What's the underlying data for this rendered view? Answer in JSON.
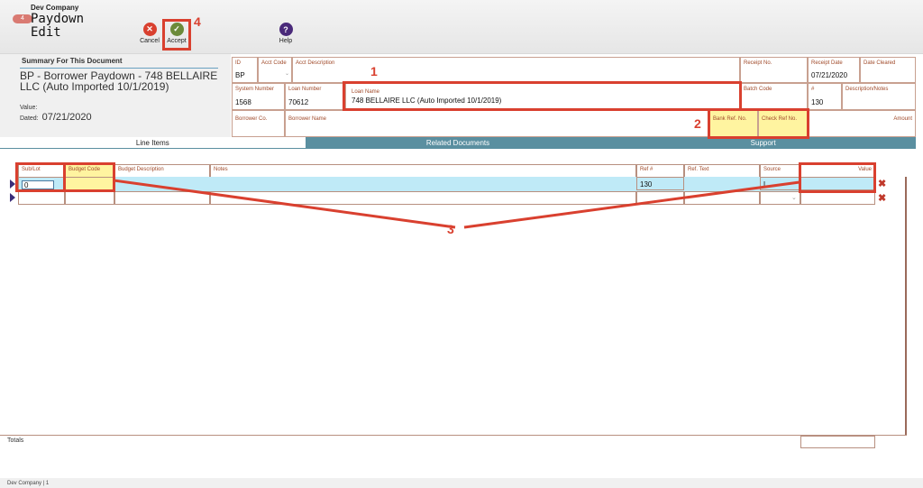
{
  "header": {
    "company": "Dev Company",
    "notifications": "4",
    "module_title_line1": "Paydown",
    "module_title_line2": "Edit",
    "cancel_label": "Cancel",
    "accept_label": "Accept",
    "help_label": "Help"
  },
  "summary": {
    "heading": "Summary For This Document",
    "title": "BP - Borrower Paydown - 748 BELLAIRE LLC (Auto Imported 10/1/2019)",
    "value_label": "Value:",
    "dated_label": "Dated:",
    "dated_value": "07/21/2020"
  },
  "fields": {
    "id": {
      "label": "ID",
      "value": "BP"
    },
    "acct_code": {
      "label": "Acct Code",
      "value": ""
    },
    "acct_description": {
      "label": "Acct Description",
      "value": ""
    },
    "receipt_no": {
      "label": "Receipt No.",
      "value": ""
    },
    "receipt_date": {
      "label": "Receipt Date",
      "value": "07/21/2020"
    },
    "date_cleared": {
      "label": "Date Cleared",
      "value": ""
    },
    "system_number": {
      "label": "System Number",
      "value": "1568"
    },
    "loan_number": {
      "label": "Loan Number",
      "value": "70612"
    },
    "loan_name": {
      "label": "Loan Name",
      "value": "748 BELLAIRE LLC (Auto Imported 10/1/2019)"
    },
    "batch_code": {
      "label": "Batch Code",
      "value": ""
    },
    "number": {
      "label": "#",
      "value": "130"
    },
    "description_notes": {
      "label": "Description/Notes",
      "value": ""
    },
    "borrower_co": {
      "label": "Borrower Co.",
      "value": ""
    },
    "borrower_name": {
      "label": "Borrower Name",
      "value": ""
    },
    "bank_ref_no": {
      "label": "Bank Ref. No.",
      "value": ""
    },
    "check_ref_no": {
      "label": "Check Ref No.",
      "value": ""
    },
    "amount": {
      "label": "Amount",
      "value": ""
    }
  },
  "tabs": [
    "Line Items",
    "Related Documents",
    "Support"
  ],
  "grid": {
    "columns": [
      "Sub/Lot",
      "Budget Code",
      "Budget Description",
      "Notes",
      "Ref #",
      "Ref. Text",
      "Source",
      "Value"
    ],
    "rows": [
      {
        "sub_lot": "0",
        "budget_code": "",
        "budget_description": "",
        "notes": "",
        "ref": "130",
        "ref_text": "",
        "source": "L",
        "value": ""
      },
      {
        "sub_lot": "",
        "budget_code": "",
        "budget_description": "",
        "notes": "",
        "ref": "",
        "ref_text": "",
        "source": "",
        "value": ""
      }
    ],
    "totals_label": "Totals"
  },
  "callouts": [
    "1",
    "2",
    "3",
    "4"
  ],
  "footer": {
    "text": "Dev Company | 1"
  },
  "colors": {
    "accent": "#5a8fa0",
    "highlight": "#fff4a0",
    "callout": "#d9402f",
    "selected_row": "#bfeaf7"
  },
  "icons": [
    "cancel-icon",
    "accept-icon",
    "help-icon",
    "remove-row-icon",
    "row-pointer-icon",
    "chevron-down-icon"
  ]
}
